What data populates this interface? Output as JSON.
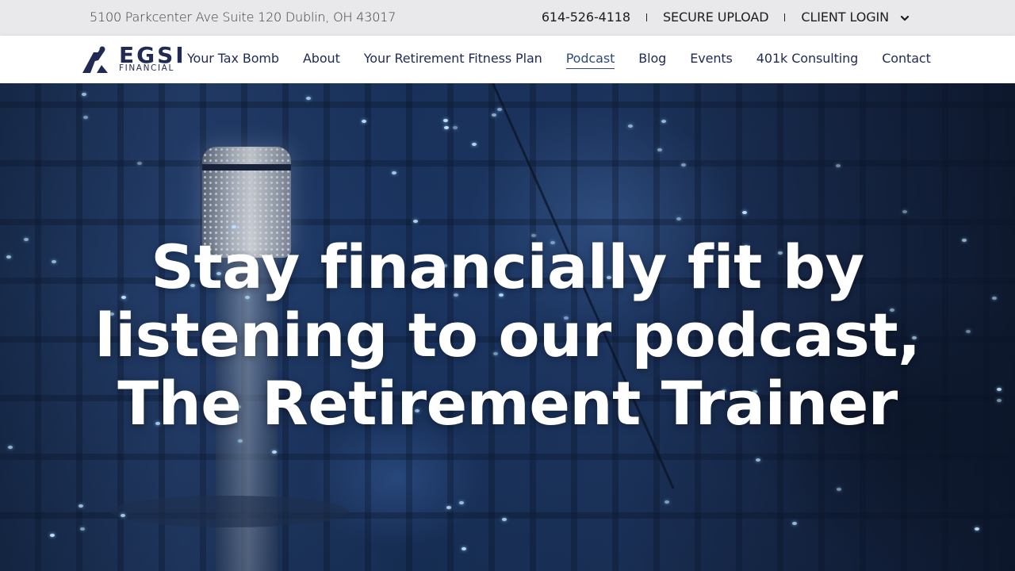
{
  "topbar": {
    "address": "5100 Parkcenter Ave Suite 120 Dublin, OH 43017",
    "phone": "614-526-4118",
    "secure_upload": "SECURE UPLOAD",
    "client_login": "CLIENT LOGIN"
  },
  "logo": {
    "name": "EGSI",
    "subtitle": "FINANCIAL"
  },
  "nav": {
    "items": [
      {
        "label": "Your Tax Bomb"
      },
      {
        "label": "About"
      },
      {
        "label": "Your Retirement Fitness Plan"
      },
      {
        "label": "Podcast",
        "active": true
      },
      {
        "label": "Blog"
      },
      {
        "label": "Events"
      },
      {
        "label": "401k Consulting"
      },
      {
        "label": "Contact"
      }
    ]
  },
  "hero": {
    "headline_lines": [
      "Stay financially fit by",
      "listening to our podcast,",
      "The Retirement Trainer"
    ]
  },
  "colors": {
    "brand_navy": "#1f2a55",
    "topbar_bg": "#e9e9eb",
    "active_link": "#2d4a7a",
    "headline": "#ffffff"
  }
}
